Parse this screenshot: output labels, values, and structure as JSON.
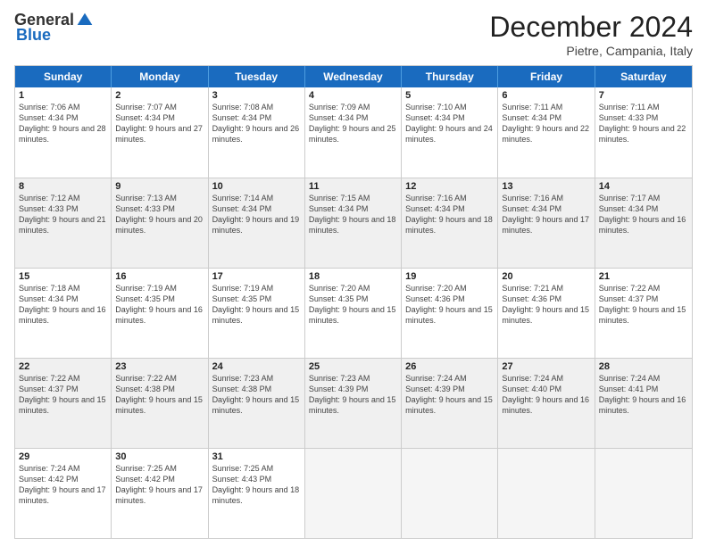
{
  "logo": {
    "general": "General",
    "blue": "Blue"
  },
  "title": "December 2024",
  "location": "Pietre, Campania, Italy",
  "headers": [
    "Sunday",
    "Monday",
    "Tuesday",
    "Wednesday",
    "Thursday",
    "Friday",
    "Saturday"
  ],
  "weeks": [
    [
      {
        "day": "1",
        "sunrise": "7:06 AM",
        "sunset": "4:34 PM",
        "daylight": "9 hours and 28 minutes.",
        "shaded": false
      },
      {
        "day": "2",
        "sunrise": "7:07 AM",
        "sunset": "4:34 PM",
        "daylight": "9 hours and 27 minutes.",
        "shaded": false
      },
      {
        "day": "3",
        "sunrise": "7:08 AM",
        "sunset": "4:34 PM",
        "daylight": "9 hours and 26 minutes.",
        "shaded": false
      },
      {
        "day": "4",
        "sunrise": "7:09 AM",
        "sunset": "4:34 PM",
        "daylight": "9 hours and 25 minutes.",
        "shaded": false
      },
      {
        "day": "5",
        "sunrise": "7:10 AM",
        "sunset": "4:34 PM",
        "daylight": "9 hours and 24 minutes.",
        "shaded": false
      },
      {
        "day": "6",
        "sunrise": "7:11 AM",
        "sunset": "4:34 PM",
        "daylight": "9 hours and 22 minutes.",
        "shaded": false
      },
      {
        "day": "7",
        "sunrise": "7:11 AM",
        "sunset": "4:33 PM",
        "daylight": "9 hours and 22 minutes.",
        "shaded": false
      }
    ],
    [
      {
        "day": "8",
        "sunrise": "7:12 AM",
        "sunset": "4:33 PM",
        "daylight": "9 hours and 21 minutes.",
        "shaded": true
      },
      {
        "day": "9",
        "sunrise": "7:13 AM",
        "sunset": "4:33 PM",
        "daylight": "9 hours and 20 minutes.",
        "shaded": true
      },
      {
        "day": "10",
        "sunrise": "7:14 AM",
        "sunset": "4:34 PM",
        "daylight": "9 hours and 19 minutes.",
        "shaded": true
      },
      {
        "day": "11",
        "sunrise": "7:15 AM",
        "sunset": "4:34 PM",
        "daylight": "9 hours and 18 minutes.",
        "shaded": true
      },
      {
        "day": "12",
        "sunrise": "7:16 AM",
        "sunset": "4:34 PM",
        "daylight": "9 hours and 18 minutes.",
        "shaded": true
      },
      {
        "day": "13",
        "sunrise": "7:16 AM",
        "sunset": "4:34 PM",
        "daylight": "9 hours and 17 minutes.",
        "shaded": true
      },
      {
        "day": "14",
        "sunrise": "7:17 AM",
        "sunset": "4:34 PM",
        "daylight": "9 hours and 16 minutes.",
        "shaded": true
      }
    ],
    [
      {
        "day": "15",
        "sunrise": "7:18 AM",
        "sunset": "4:34 PM",
        "daylight": "9 hours and 16 minutes.",
        "shaded": false
      },
      {
        "day": "16",
        "sunrise": "7:19 AM",
        "sunset": "4:35 PM",
        "daylight": "9 hours and 16 minutes.",
        "shaded": false
      },
      {
        "day": "17",
        "sunrise": "7:19 AM",
        "sunset": "4:35 PM",
        "daylight": "9 hours and 15 minutes.",
        "shaded": false
      },
      {
        "day": "18",
        "sunrise": "7:20 AM",
        "sunset": "4:35 PM",
        "daylight": "9 hours and 15 minutes.",
        "shaded": false
      },
      {
        "day": "19",
        "sunrise": "7:20 AM",
        "sunset": "4:36 PM",
        "daylight": "9 hours and 15 minutes.",
        "shaded": false
      },
      {
        "day": "20",
        "sunrise": "7:21 AM",
        "sunset": "4:36 PM",
        "daylight": "9 hours and 15 minutes.",
        "shaded": false
      },
      {
        "day": "21",
        "sunrise": "7:22 AM",
        "sunset": "4:37 PM",
        "daylight": "9 hours and 15 minutes.",
        "shaded": false
      }
    ],
    [
      {
        "day": "22",
        "sunrise": "7:22 AM",
        "sunset": "4:37 PM",
        "daylight": "9 hours and 15 minutes.",
        "shaded": true
      },
      {
        "day": "23",
        "sunrise": "7:22 AM",
        "sunset": "4:38 PM",
        "daylight": "9 hours and 15 minutes.",
        "shaded": true
      },
      {
        "day": "24",
        "sunrise": "7:23 AM",
        "sunset": "4:38 PM",
        "daylight": "9 hours and 15 minutes.",
        "shaded": true
      },
      {
        "day": "25",
        "sunrise": "7:23 AM",
        "sunset": "4:39 PM",
        "daylight": "9 hours and 15 minutes.",
        "shaded": true
      },
      {
        "day": "26",
        "sunrise": "7:24 AM",
        "sunset": "4:39 PM",
        "daylight": "9 hours and 15 minutes.",
        "shaded": true
      },
      {
        "day": "27",
        "sunrise": "7:24 AM",
        "sunset": "4:40 PM",
        "daylight": "9 hours and 16 minutes.",
        "shaded": true
      },
      {
        "day": "28",
        "sunrise": "7:24 AM",
        "sunset": "4:41 PM",
        "daylight": "9 hours and 16 minutes.",
        "shaded": true
      }
    ],
    [
      {
        "day": "29",
        "sunrise": "7:24 AM",
        "sunset": "4:42 PM",
        "daylight": "9 hours and 17 minutes.",
        "shaded": false
      },
      {
        "day": "30",
        "sunrise": "7:25 AM",
        "sunset": "4:42 PM",
        "daylight": "9 hours and 17 minutes.",
        "shaded": false
      },
      {
        "day": "31",
        "sunrise": "7:25 AM",
        "sunset": "4:43 PM",
        "daylight": "9 hours and 18 minutes.",
        "shaded": false
      },
      null,
      null,
      null,
      null
    ]
  ]
}
